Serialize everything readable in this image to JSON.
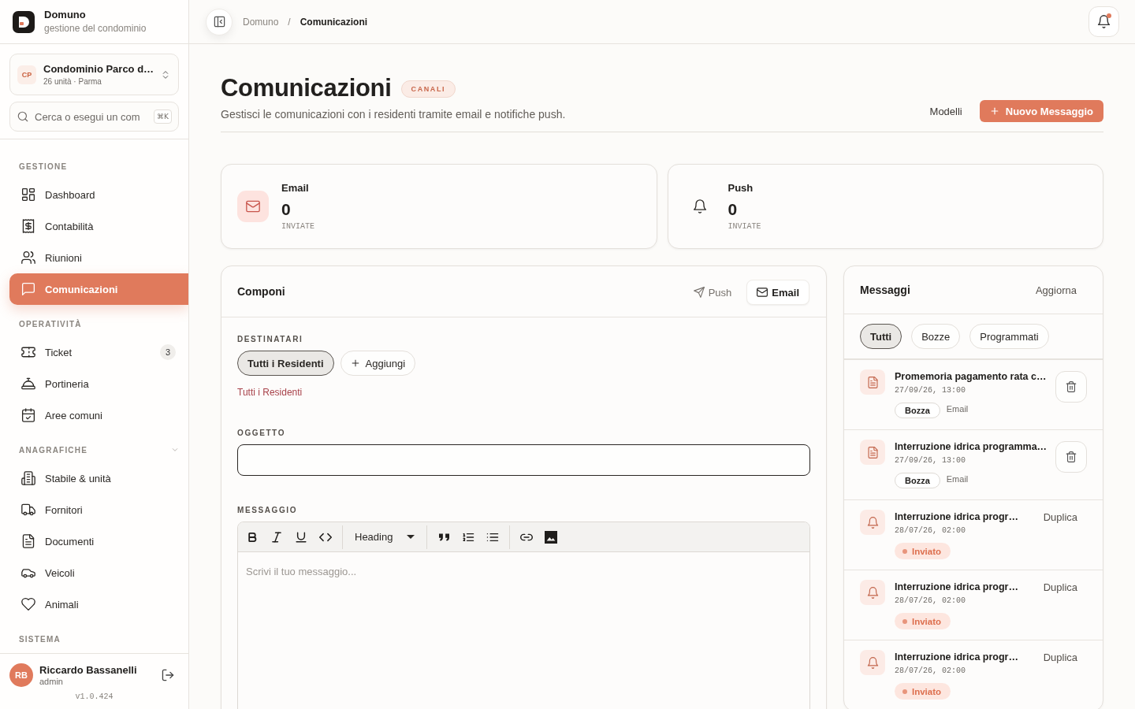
{
  "header": {
    "breadcrumb": [
      {
        "label": "Domuno",
        "current": false
      },
      {
        "label": "Comunicazioni",
        "current": true
      }
    ],
    "separator": "/",
    "notifications": {
      "unread": true
    }
  },
  "sidebar": {
    "brand": {
      "name": "Domuno",
      "tagline": "gestione del condominio"
    },
    "building": {
      "initials": "CP",
      "name": "Condominio Parco d…",
      "details": "26 unità · Parma"
    },
    "search": {
      "placeholder": "Cerca o esegui un com",
      "shortcut": "⌘K"
    },
    "sections": [
      {
        "title": "GESTIONE",
        "collapsible": false,
        "items": [
          {
            "label": "Dashboard",
            "selected": false
          },
          {
            "label": "Contabilità",
            "selected": false
          },
          {
            "label": "Riunioni",
            "selected": false
          },
          {
            "label": "Comunicazioni",
            "selected": true
          }
        ]
      },
      {
        "title": "OPERATIVITÀ",
        "collapsible": false,
        "items": [
          {
            "label": "Ticket",
            "selected": false,
            "count": "3"
          },
          {
            "label": "Portineria",
            "selected": false
          },
          {
            "label": "Aree comuni",
            "selected": false
          }
        ]
      },
      {
        "title": "ANAGRAFICHE",
        "collapsible": true,
        "items": [
          {
            "label": "Stabile & unità",
            "selected": false
          },
          {
            "label": "Fornitori",
            "selected": false
          },
          {
            "label": "Documenti",
            "selected": false
          },
          {
            "label": "Veicoli",
            "selected": false
          },
          {
            "label": "Animali",
            "selected": false
          }
        ]
      },
      {
        "title": "SISTEMA",
        "collapsible": false
      }
    ],
    "user": {
      "initials": "RB",
      "name": "Riccardo Bassanelli",
      "role": "admin"
    },
    "version": "v1.0.424"
  },
  "page": {
    "title": "Comunicazioni",
    "badge": "CANALI",
    "subtitle": "Gestisci le comunicazioni con i residenti tramite email e notifiche push.",
    "actions": [
      {
        "kind": "ghost",
        "label": "Modelli"
      },
      {
        "kind": "primary",
        "label": "Nuovo Messaggio"
      }
    ]
  },
  "stats": [
    {
      "kind": "email",
      "label": "Email",
      "value": "0",
      "caption": "INVIATE"
    },
    {
      "kind": "push",
      "label": "Push",
      "value": "0",
      "caption": "INVIATE"
    }
  ],
  "compose": {
    "title": "Componi",
    "channels": [
      {
        "label": "Push",
        "selected": false
      },
      {
        "label": "Email",
        "selected": true
      }
    ],
    "recipients_label": "DESTINATARI",
    "recipients": [
      {
        "label": "Tutti i Residenti",
        "selected": true
      }
    ],
    "add_label": "Aggiungi",
    "recipients_summary": "Tutti i Residenti",
    "subject_label": "OGGETTO",
    "message_label": "MESSAGGIO",
    "editor": {
      "heading": "Heading",
      "placeholder": "Scrivi il tuo messaggio..."
    }
  },
  "messages": {
    "title": "Messaggi",
    "refresh": "Aggiorna",
    "filters": [
      {
        "label": "Tutti",
        "selected": true
      },
      {
        "label": "Bozze",
        "selected": false
      },
      {
        "label": "Programmati",
        "selected": false
      }
    ],
    "rows": [
      {
        "kind": "draft",
        "title": "Promemoria pagamento rata c…",
        "date": "27/09/26, 13:00",
        "status": "Bozza",
        "channel": "Email"
      },
      {
        "kind": "draft",
        "title": "Interruzione idrica programma…",
        "date": "27/09/26, 13:00",
        "status": "Bozza",
        "channel": "Email"
      },
      {
        "kind": "sent",
        "title": "Interruzione idrica progr…",
        "date": "28/07/26, 02:00",
        "status": "Inviato",
        "action": "Duplica"
      },
      {
        "kind": "sent",
        "title": "Interruzione idrica progr…",
        "date": "28/07/26, 02:00",
        "status": "Inviato",
        "action": "Duplica"
      },
      {
        "kind": "sent",
        "title": "Interruzione idrica progr…",
        "date": "28/07/26, 02:00",
        "status": "Inviato",
        "action": "Duplica"
      }
    ]
  }
}
